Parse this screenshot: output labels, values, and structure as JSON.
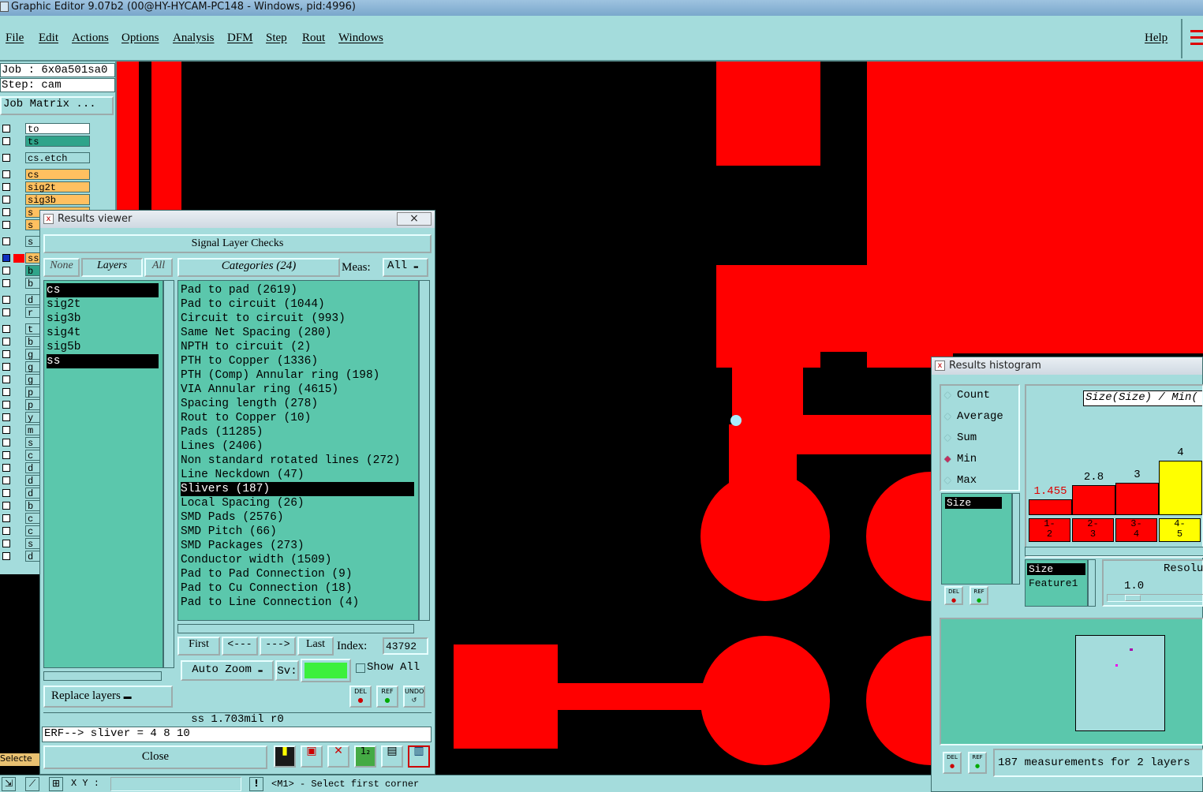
{
  "app": {
    "title": "Graphic Editor 9.07b2 (00@HY-HYCAM-PC148 - Windows, pid:4996)"
  },
  "menu": [
    "File",
    "Edit",
    "Actions",
    "Options",
    "Analysis",
    "DFM",
    "Step",
    "Rout",
    "Windows"
  ],
  "help": "Help",
  "job": {
    "job": "Job : 6x0a501sa0",
    "step": "Step: cam",
    "matrix": "Job Matrix ..."
  },
  "layers": [
    "to",
    "ts",
    "cs.etch",
    "cs",
    "sig2t",
    "sig3b",
    "s",
    "s",
    "s",
    "ss",
    "b",
    "b",
    "d",
    "r",
    "t",
    "b",
    "g",
    "g",
    "g",
    "p",
    "p",
    "y",
    "m",
    "s",
    "c",
    "d",
    "d",
    "d",
    "b",
    "c",
    "c",
    "s",
    "d"
  ],
  "selected_label": "Selecte",
  "results_viewer": {
    "title": "Results viewer",
    "close_x": "×",
    "header": "Signal Layer Checks",
    "none": "None",
    "layers_btn": "Layers",
    "all": "All",
    "categories_btn": "Categories (24)",
    "meas_label": "Meas:",
    "meas_value": "All",
    "layer_list": [
      "cs",
      "sig2t",
      "sig3b",
      "sig4t",
      "sig5b",
      "ss"
    ],
    "categories": [
      "Pad to pad (2619)",
      "Pad to circuit (1044)",
      "Circuit to circuit (993)",
      "Same Net Spacing (280)",
      "NPTH to circuit (2)",
      "PTH to Copper (1336)",
      "PTH (Comp) Annular ring (198)",
      "VIA Annular ring (4615)",
      "Spacing length (278)",
      "Rout to Copper (10)",
      "Pads (11285)",
      "Lines (2406)",
      "Non standard rotated lines (272)",
      "Line Neckdown (47)",
      "Slivers (187)",
      "Local Spacing (26)",
      "SMD Pads (2576)",
      "SMD Pitch (66)",
      "SMD Packages (273)",
      "Conductor width (1509)",
      "Pad to Pad Connection (9)",
      "Pad to Cu Connection (18)",
      "Pad to Line Connection (4)"
    ],
    "nav": {
      "first": "First",
      "prev": "<---",
      "next": "--->",
      "last": "Last",
      "index_label": "Index:",
      "index_value": "43792"
    },
    "auto_zoom": "Auto Zoom",
    "sv": "Sv:",
    "show_all": "Show All",
    "replace_layers": "Replace layers",
    "status": "ss 1.703mil  r0",
    "erf": "ERF--> sliver = 4 8 10",
    "close": "Close",
    "del": "DEL",
    "ref": "REF",
    "undo": "UNDO"
  },
  "histogram": {
    "title": "Results histogram",
    "modes": [
      "Count",
      "Average",
      "Sum",
      "Min",
      "Max"
    ],
    "selected_mode": "Min",
    "chart_title": "Size(Size) / Min(",
    "list": [
      "Size"
    ],
    "bars": [
      {
        "label": "1.455",
        "bin": "1-\n2",
        "value": 1.455
      },
      {
        "label": "2.8",
        "bin": "2-\n3",
        "value": 2.8
      },
      {
        "label": "3",
        "bin": "3-\n4",
        "value": 3
      },
      {
        "label": "4",
        "bin": "4-\n5",
        "value": 4
      }
    ],
    "fields": [
      "Size",
      "Feature1"
    ],
    "resolution_label": "Resolu",
    "resolution_value": "1.0",
    "del": "DEL",
    "ref": "REF",
    "footer": "187 measurements for 2 layers"
  },
  "bottom": {
    "xy": "X Y :",
    "hint": "<M1> - Select first corner"
  },
  "colors": {
    "teal": "#5bc7ac",
    "panel": "#a4dcdc",
    "copper": "#ff0000",
    "hist_red": "#ff0000",
    "hist_yellow": "#ffff00"
  }
}
